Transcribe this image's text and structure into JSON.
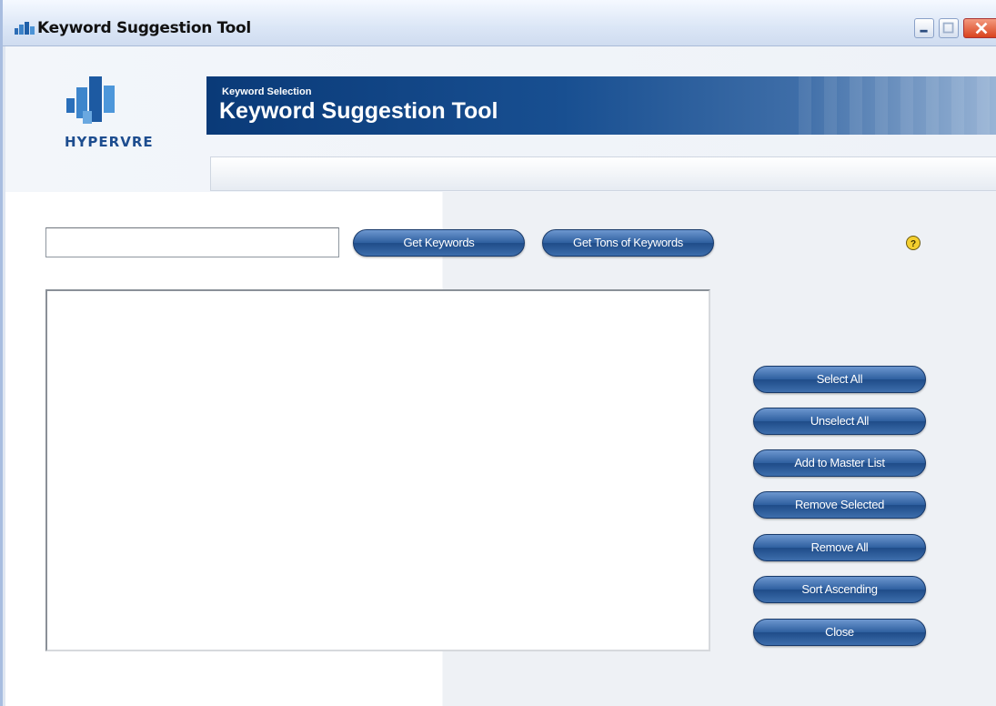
{
  "window": {
    "title": "Keyword Suggestion Tool",
    "icon": "app-logo-icon",
    "controls": [
      "minimize-icon",
      "maximize-icon",
      "close-icon"
    ]
  },
  "header": {
    "logo_text": "HYPERVRE",
    "banner_subtitle": "Keyword Selection",
    "banner_title": "Keyword Suggestion Tool"
  },
  "search": {
    "value": "",
    "get_keywords_label": "Get Keywords",
    "get_tons_label": "Get Tons of Keywords"
  },
  "help_icon": "help-icon",
  "actions": {
    "select_all": "Select All",
    "unselect_all": "Unselect All",
    "add_to_master": "Add to Master List",
    "remove_selected": "Remove Selected",
    "remove_all": "Remove All",
    "sort_ascending": "Sort Ascending",
    "close": "Close"
  },
  "keyword_list": {
    "items": []
  },
  "colors": {
    "accent": "#1f4c89",
    "banner": "#0a3a78",
    "logo": "#1d4d8f"
  }
}
